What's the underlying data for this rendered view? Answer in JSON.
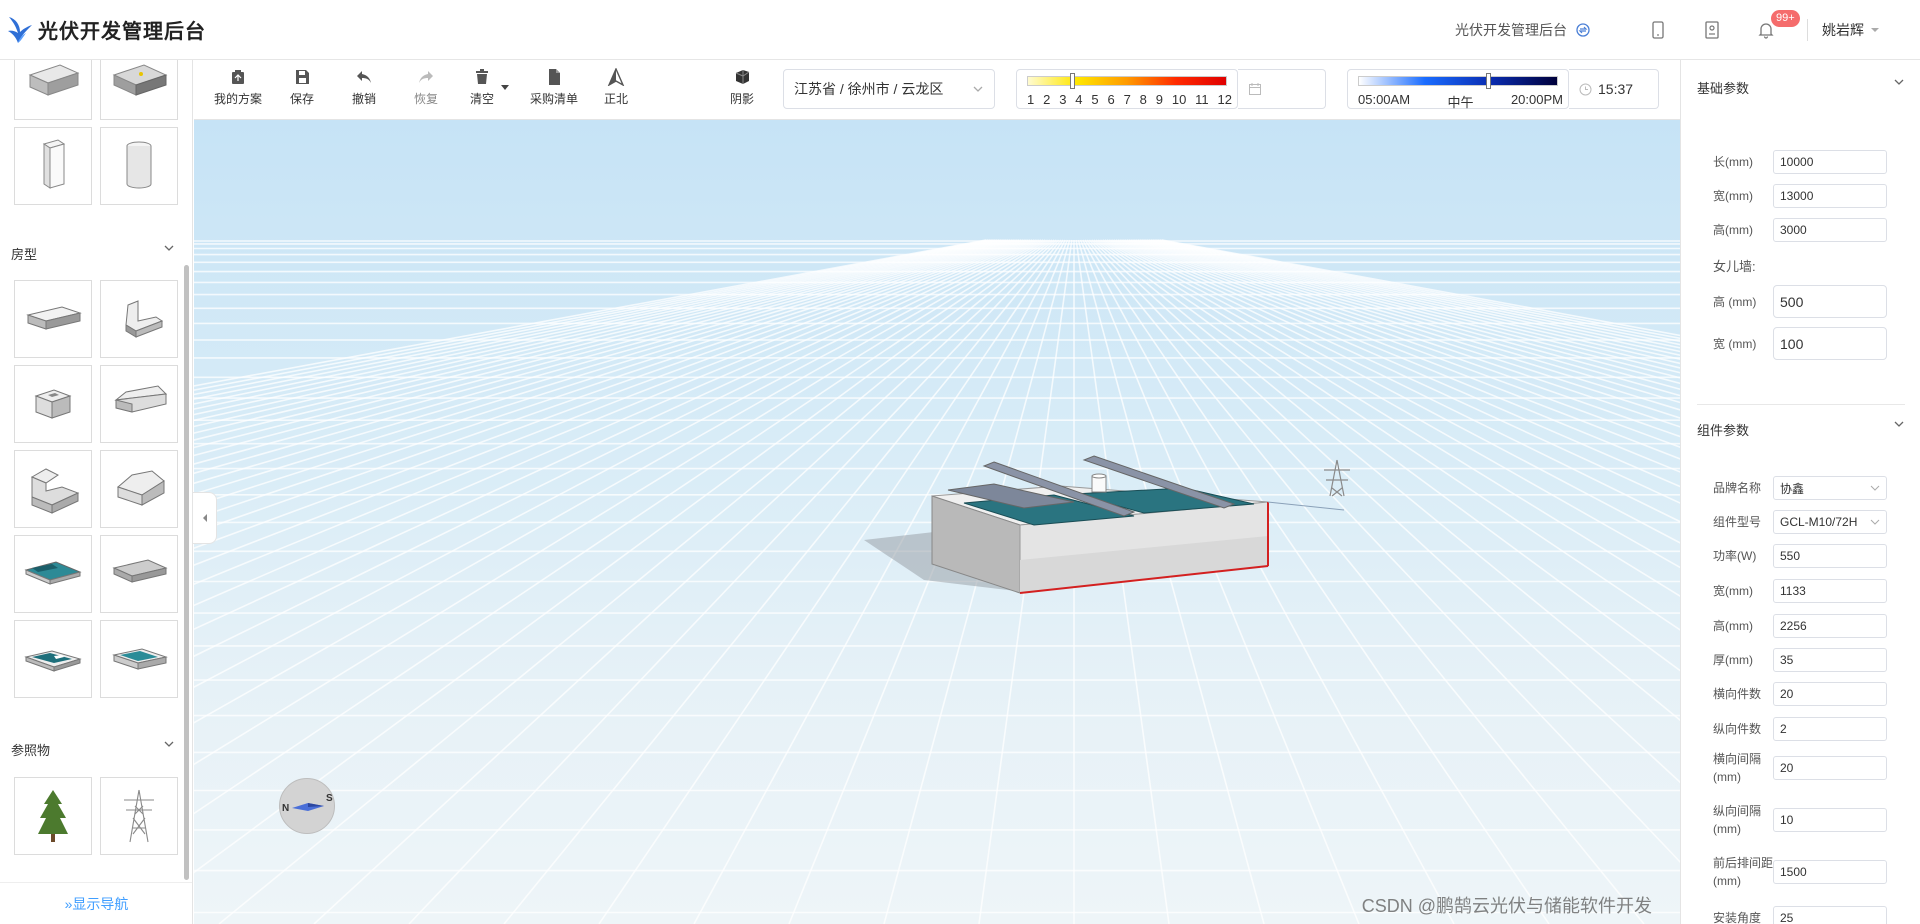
{
  "app": {
    "title": "光伏开发管理后台",
    "header_title": "光伏开发管理后台",
    "badge": "99+",
    "user": "姚岩辉"
  },
  "left": {
    "section_house": "房型",
    "section_reference": "参照物",
    "show_nav": "»显示导航",
    "top_tiles": [
      "inverter-box-tile",
      "transformer-tile",
      "cuboid-tile",
      "cylinder-tile"
    ],
    "house_tiles": [
      "flat-roof-house",
      "l-shape-house",
      "courtyard-house",
      "gable-roof-house",
      "stepped-house",
      "hip-roof-house",
      "pv-flat-roof",
      "slope-roof-house",
      "pv-low-house",
      "pv-panel-house"
    ],
    "reference_tiles": [
      "tree",
      "power-tower"
    ]
  },
  "toolbar": {
    "my_plan": "我的方案",
    "save": "保存",
    "undo": "撤销",
    "redo": "恢复",
    "clear": "清空",
    "purchase_list": "采购清单",
    "north": "正北",
    "shadow": "阴影",
    "region": "江苏省 / 徐州市 / 云龙区",
    "months": [
      "1",
      "2",
      "3",
      "4",
      "5",
      "6",
      "7",
      "8",
      "9",
      "10",
      "11",
      "12"
    ],
    "month_value": 3.5,
    "time_start": "05:00AM",
    "time_mid": "中午",
    "time_end": "20:00PM",
    "time_value": 0.65,
    "clock": "15:37"
  },
  "viewport": {
    "compass_n": "N",
    "compass_s": "S",
    "watermark": "CSDN @鹏鹄云光伏与储能软件开发"
  },
  "right": {
    "basic_title": "基础参数",
    "length_label": "长(mm)",
    "length_value": "10000",
    "width_label": "宽(mm)",
    "width_value": "13000",
    "height_label": "高(mm)",
    "height_value": "3000",
    "parapet_label": "女儿墙:",
    "parapet_h_label": "高 (mm)",
    "parapet_h_value": "500",
    "parapet_w_label": "宽 (mm)",
    "parapet_w_value": "100",
    "component_title": "组件参数",
    "brand_label": "品牌名称",
    "brand_value": "协鑫",
    "model_label": "组件型号",
    "model_value": "GCL-M10/72H",
    "power_label": "功率(W)",
    "power_value": "550",
    "c_width_label": "宽(mm)",
    "c_width_value": "1133",
    "c_height_label": "高(mm)",
    "c_height_value": "2256",
    "thick_label": "厚(mm)",
    "thick_value": "35",
    "h_count_label": "横向件数",
    "h_count_value": "20",
    "v_count_label": "纵向件数",
    "v_count_value": "2",
    "h_gap_label": "横向间隔\n(mm)",
    "h_gap_value": "20",
    "v_gap_label": "纵向间隔\n(mm)",
    "v_gap_value": "10",
    "row_gap_label": "前后排间距\n(mm)",
    "row_gap_value": "1500",
    "angle_label": "安装角度",
    "angle_value": "25"
  },
  "colors": {
    "accent": "#409eff",
    "badge": "#f56c6c",
    "pv_panel": "#1f6f7c"
  }
}
